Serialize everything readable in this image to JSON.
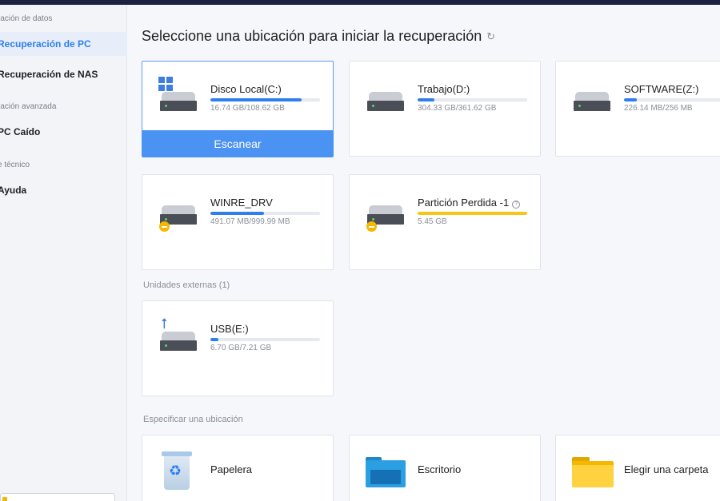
{
  "sidebar": {
    "sections": [
      {
        "label": "ración de datos"
      },
      {
        "label": "ración avanzada"
      },
      {
        "label": "e técnico"
      }
    ],
    "items": [
      {
        "label": "Recuperación de PC",
        "active": true
      },
      {
        "label": "Recuperación de NAS",
        "active": false
      },
      {
        "label": "PC Caído",
        "active": false
      },
      {
        "label": "Ayuda",
        "active": false
      }
    ]
  },
  "main": {
    "title": "Seleccione una ubicación para iniciar la recuperación",
    "refresh_icon": "refresh-icon",
    "drives": [
      {
        "name": "Disco Local(C:)",
        "size": "16.74 GB/108.62 GB",
        "usage": 0.83,
        "icon": "windows-drive-icon",
        "selected": true
      },
      {
        "name": "Trabajo(D:)",
        "size": "304.33 GB/361.62 GB",
        "usage": 0.15,
        "icon": "drive-icon",
        "selected": false
      },
      {
        "name": "SOFTWARE(Z:)",
        "size": "226.14 MB/256 MB",
        "usage": 0.12,
        "icon": "drive-icon",
        "selected": false
      },
      {
        "name": "WINRE_DRV",
        "size": "491.07 MB/999.99 MB",
        "usage": 0.49,
        "icon": "drive-warning-icon",
        "selected": false
      },
      {
        "name": "Partición Perdida -1",
        "size": "5.45 GB",
        "usage": 1.0,
        "icon": "drive-warning-icon",
        "selected": false
      }
    ],
    "scan_button": "Escanear",
    "external_label": "Unidades externas (1)",
    "external": [
      {
        "name": "USB(E:)",
        "size": "6.70 GB/7.21 GB",
        "usage": 0.07,
        "icon": "usb-drive-icon"
      }
    ],
    "locations_label": "Especificar una ubicación",
    "locations": [
      {
        "name": "Papelera",
        "icon": "recycle-bin-icon"
      },
      {
        "name": "Escritorio",
        "icon": "desktop-folder-icon"
      },
      {
        "name": "Elegir una carpeta",
        "icon": "folder-icon"
      }
    ],
    "colors": {
      "accent": "#2f7ef0",
      "scan_button": "#4b93f3",
      "lost_partition_bar": "#f5c518",
      "warning": "#f5b800"
    }
  }
}
